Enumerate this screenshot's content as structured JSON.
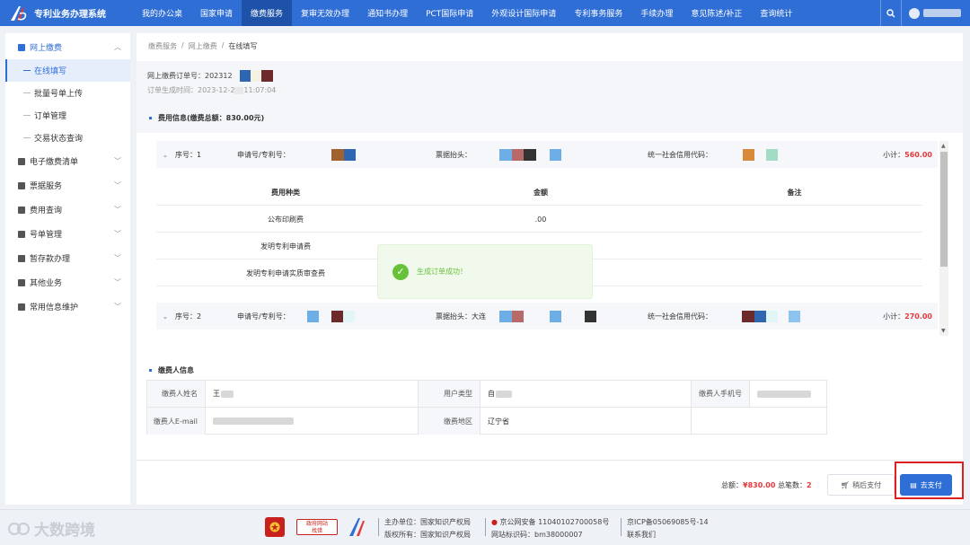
{
  "header": {
    "system_name": "专利业务办理系统",
    "nav": [
      "我的办公桌",
      "国家申请",
      "缴费服务",
      "复审无效办理",
      "通知书办理",
      "PCT国际申请",
      "外观设计国际申请",
      "专利事务服务",
      "手续办理",
      "意见陈述/补正",
      "查询统计"
    ],
    "active_nav": "缴费服务"
  },
  "sidebar": {
    "groups": [
      {
        "label": "网上缴费",
        "icon": "wallet-icon",
        "expanded": true,
        "items": [
          "在线填写",
          "批量号单上传",
          "订单管理",
          "交易状态查询"
        ],
        "active_item": "在线填写"
      },
      {
        "label": "电子缴费清单",
        "icon": "list-icon"
      },
      {
        "label": "票据服务",
        "icon": "receipt-icon"
      },
      {
        "label": "费用查询",
        "icon": "search-doc-icon"
      },
      {
        "label": "号单管理",
        "icon": "folder-icon"
      },
      {
        "label": "暂存款办理",
        "icon": "deposit-icon"
      },
      {
        "label": "其他业务",
        "icon": "grid-icon"
      },
      {
        "label": "常用信息维护",
        "icon": "edit-icon"
      }
    ]
  },
  "breadcrumb": [
    "缴费服务",
    "网上缴费",
    "在线填写"
  ],
  "order": {
    "no_label": "网上缴费订单号：",
    "no_value": "202312",
    "time_label": "订单生成时间：",
    "time_value": "2023-12-2",
    "time_tail": "11:07:04"
  },
  "fee_info": {
    "title": "费用信息(缴费总额：830.00元)",
    "columns": [
      "费用种类",
      "金额",
      "备注"
    ],
    "groups": [
      {
        "seq_label": "序号：1",
        "app_label": "申请号/专利号：",
        "invoice_label": "票据抬头：",
        "credit_label": "统一社会信用代码：",
        "subtotal_label": "小计：",
        "subtotal": "560.00",
        "rows": [
          {
            "type": "公布印刷费",
            "amount": ".00",
            "note": ""
          },
          {
            "type": "发明专利申请费",
            "amount": "",
            "note": ""
          },
          {
            "type": "发明专利申请实质审查费",
            "amount": "",
            "note": ""
          }
        ]
      },
      {
        "seq_label": "序号：2",
        "app_label": "申请号/专利号：",
        "invoice_label": "票据抬头：大连",
        "credit_label": "统一社会信用代码：",
        "subtotal_label": "小计：",
        "subtotal": "270.00"
      }
    ]
  },
  "toast": {
    "message": "生成订单成功！"
  },
  "payer": {
    "title": "缴费人信息",
    "name_label": "缴费人姓名",
    "name_value": "王",
    "user_type_label": "用户类型",
    "user_type_value": "自",
    "phone_label": "缴费人手机号",
    "email_label": "缴费人E-mail",
    "region_label": "缴费地区",
    "region_value": "辽宁省"
  },
  "summary": {
    "total_label": "总额：",
    "total_value": "¥830.00",
    "count_label": "总笔数：",
    "count_value": "2",
    "later_label": "稍后支付",
    "pay_label": "去支付"
  },
  "site_footer": {
    "watermark": "大数跨境",
    "badge_line1": "政府网站",
    "badge_line2": "找错",
    "host": "主办单位：国家知识产权局",
    "copyright": "版权所有：国家知识产权局",
    "police": "京公网安备 11040102700058号",
    "site_id": "网站标识码：bm38000007",
    "icp": "京ICP备05069085号-14",
    "contact": "联系我们"
  },
  "colors": {
    "primary": "#2f6ed5",
    "danger": "#e4393c",
    "success": "#67c23a",
    "highlight": "#e02020"
  }
}
